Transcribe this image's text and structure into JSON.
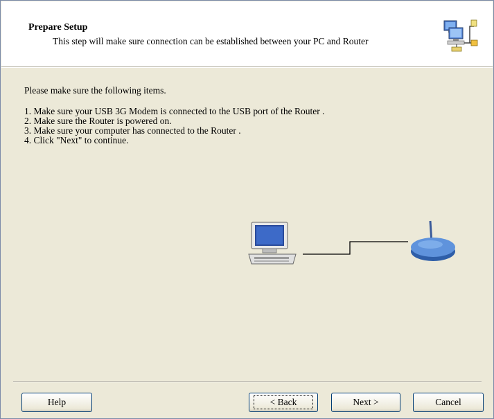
{
  "header": {
    "title": "Prepare Setup",
    "description": "This step will make sure connection can be established between your PC and Router",
    "icon": "network-setup-icon"
  },
  "content": {
    "intro": "Please make sure the following items.",
    "steps": [
      "1. Make sure your USB 3G Modem is connected to the USB port of the Router .",
      "2. Make sure the Router  is powered on.",
      "3. Make sure your computer has connected to the Router .",
      "4. Click \"Next\" to continue."
    ]
  },
  "diagram": {
    "left_icon": "computer-icon",
    "right_icon": "router-icon"
  },
  "buttons": {
    "help": "Help",
    "back": "< Back",
    "next": "Next >",
    "cancel": "Cancel"
  },
  "colors": {
    "dialog_background": "#ece9d8",
    "header_background": "#ffffff",
    "button_border": "#003c74"
  }
}
